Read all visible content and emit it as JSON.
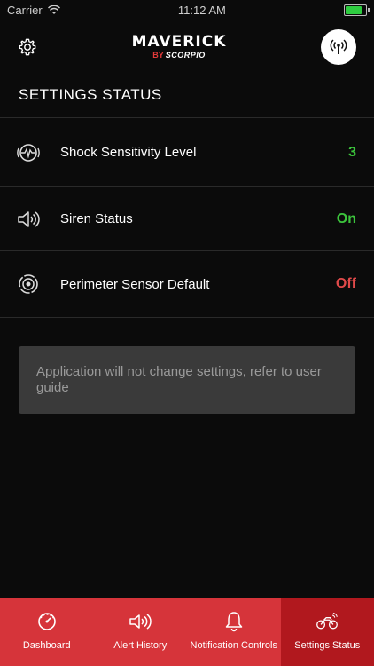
{
  "status_bar": {
    "carrier": "Carrier",
    "time": "11:12 AM"
  },
  "header": {
    "brand": "MAVERICK",
    "brand_by": "BY",
    "brand_sub": "SCORPIO",
    "settings_icon": "gear-icon",
    "signal_icon": "antenna-icon"
  },
  "page": {
    "title": "SETTINGS STATUS"
  },
  "settings": [
    {
      "icon": "shock-sensor-icon",
      "label": "Shock Sensitivity Level",
      "value": "3",
      "value_color": "#3cc43c"
    },
    {
      "icon": "speaker-icon",
      "label": "Siren Status",
      "value": "On",
      "value_color": "#3cc43c"
    },
    {
      "icon": "perimeter-sensor-icon",
      "label": "Perimeter Sensor Default",
      "value": "Off",
      "value_color": "#e14a4a"
    }
  ],
  "notice": {
    "text": "Application will not change settings, refer to user guide"
  },
  "tabs": [
    {
      "icon": "dashboard-icon",
      "label": "Dashboard",
      "active": false
    },
    {
      "icon": "alert-history-icon",
      "label": "Alert History",
      "active": false
    },
    {
      "icon": "bell-icon",
      "label": "Notification Controls",
      "active": false
    },
    {
      "icon": "motorcycle-icon",
      "label": "Settings Status",
      "active": true
    }
  ],
  "colors": {
    "accent": "#d6343a",
    "active_tab": "#b1181e",
    "on": "#3cc43c",
    "off": "#e14a4a"
  }
}
